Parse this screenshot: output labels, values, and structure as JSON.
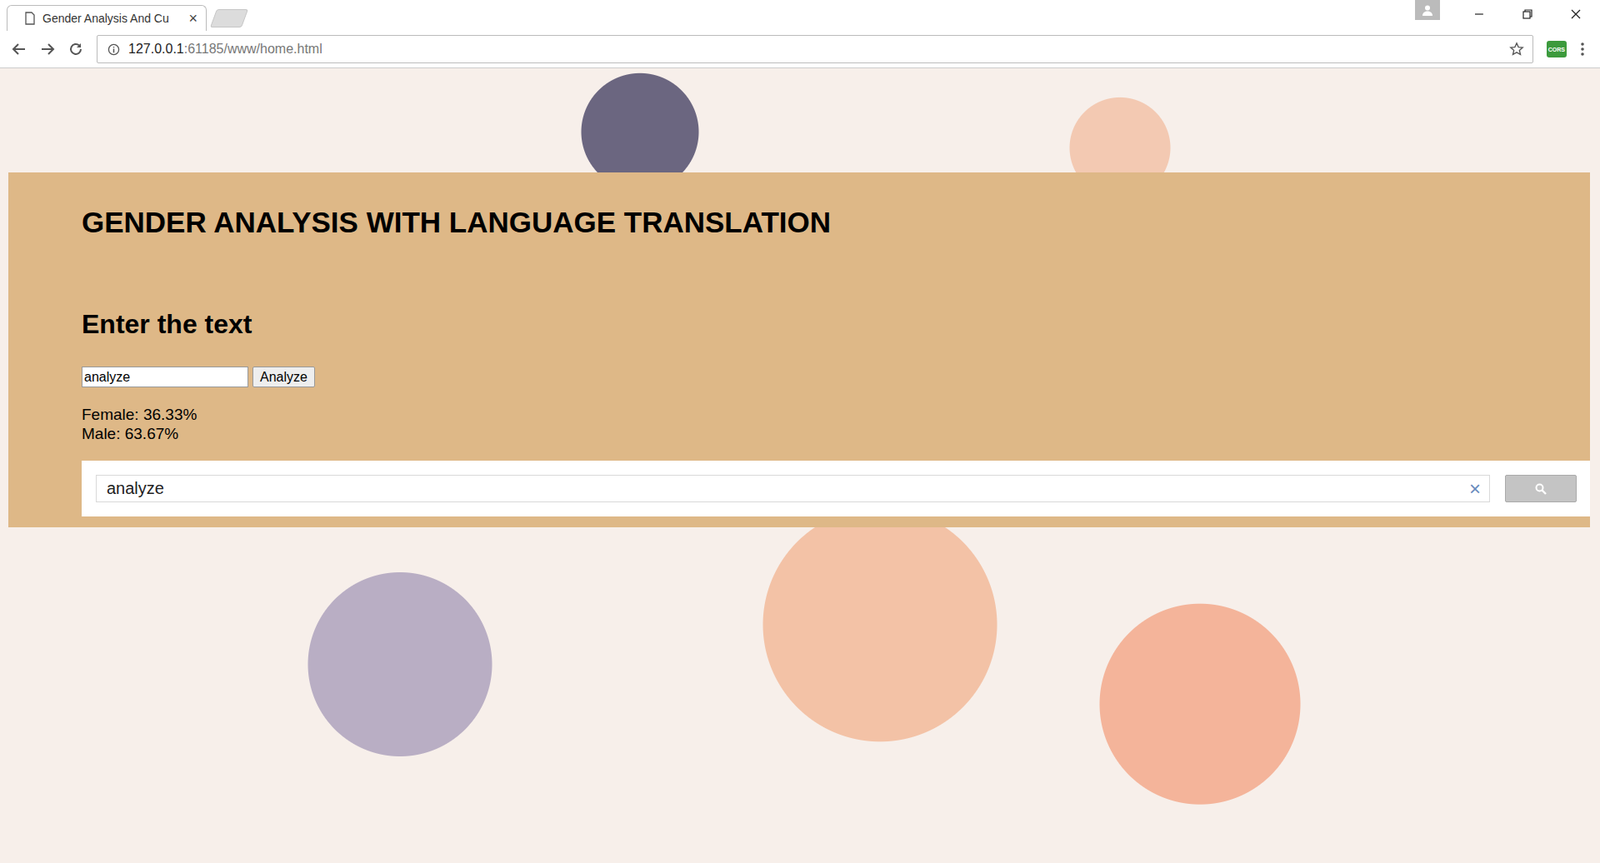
{
  "window": {
    "tab_title": "Gender Analysis And Cu",
    "tab_close": "×",
    "url_host": "127.0.0.1",
    "url_rest": ":61185/www/home.html",
    "extension": "CORS"
  },
  "page": {
    "title": "GENDER ANALYSIS WITH LANGUAGE TRANSLATION",
    "prompt": "Enter the text",
    "input_value": "analyze",
    "button": "Analyze",
    "results": [
      {
        "label": "Female: 36.33%"
      },
      {
        "label": "Male: 63.67%"
      }
    ]
  },
  "search": {
    "value": "analyze",
    "clear": "×"
  }
}
